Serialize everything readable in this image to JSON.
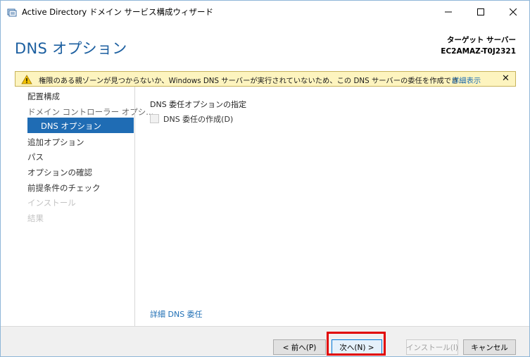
{
  "window": {
    "title": "Active Directory ドメイン サービス構成ウィザード"
  },
  "header": {
    "page_title": "DNS オプション",
    "target_label": "ターゲット サーバー",
    "target_server": "EC2AMAZ-T0J2321"
  },
  "warning": {
    "text": "権限のある親ゾーンが見つからないか、Windows DNS サーバーが実行されていないため、この DNS サーバーの委任を作成でき...",
    "details_link": "詳細表示",
    "close_glyph": "✕"
  },
  "sidebar": {
    "items": [
      {
        "label": "配置構成",
        "state": "normal"
      },
      {
        "label": "ドメイン コントローラー オプシ...",
        "state": "muted"
      },
      {
        "label": "DNS オプション",
        "state": "selected"
      },
      {
        "label": "追加オプション",
        "state": "normal"
      },
      {
        "label": "パス",
        "state": "normal"
      },
      {
        "label": "オプションの確認",
        "state": "normal"
      },
      {
        "label": "前提条件のチェック",
        "state": "normal"
      },
      {
        "label": "インストール",
        "state": "disabled"
      },
      {
        "label": "結果",
        "state": "disabled"
      }
    ]
  },
  "main": {
    "section_title": "DNS 委任オプションの指定",
    "checkbox_label": "DNS 委任の作成(D)",
    "checkbox_checked": false,
    "checkbox_enabled": false,
    "more_link": "詳細 DNS 委任"
  },
  "footer": {
    "prev_label": "< 前へ(P)",
    "next_label": "次へ(N) >",
    "install_label": "インストール(I)",
    "cancel_label": "キャンセル"
  },
  "colors": {
    "accent": "#1f6cb4",
    "title_blue": "#1c5fa0",
    "warning_bg": "#fdf4bf",
    "highlight_red": "#e10000"
  }
}
